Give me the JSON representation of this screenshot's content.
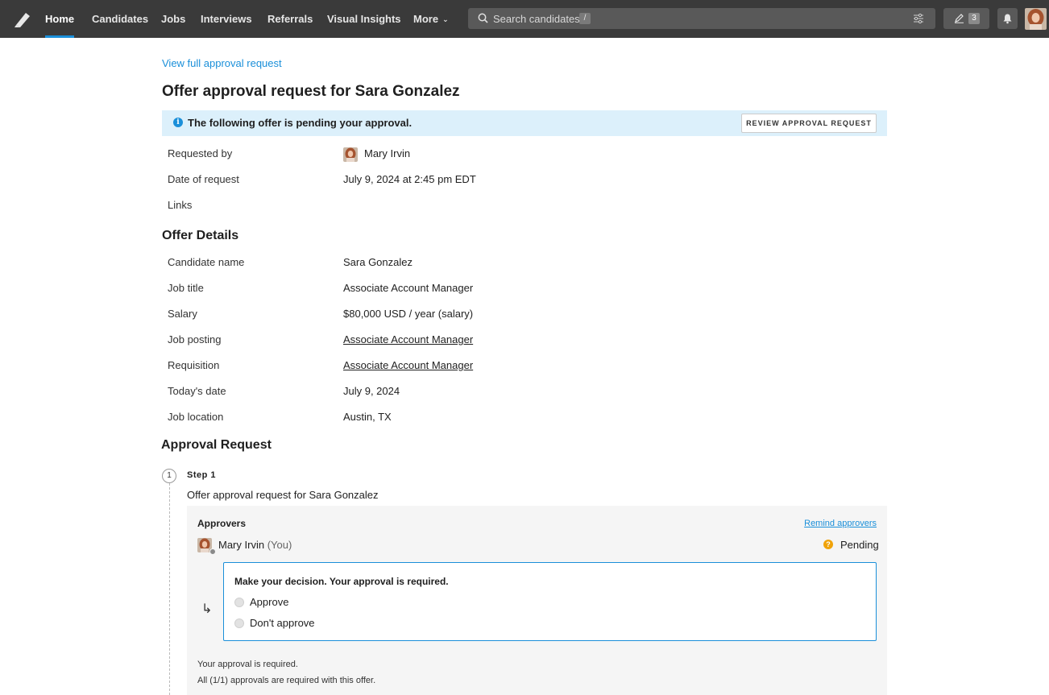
{
  "nav": {
    "items": [
      "Home",
      "Candidates",
      "Jobs",
      "Interviews",
      "Referrals",
      "Visual Insights",
      "More"
    ],
    "active": "Home",
    "search_placeholder": "Search candidates",
    "search_shortcut": "/",
    "edit_count": "3"
  },
  "page": {
    "view_full_link": "View full approval request",
    "title": "Offer approval request for Sara Gonzalez",
    "banner_text": "The following offer is pending your approval.",
    "review_button": "REVIEW APPROVAL REQUEST"
  },
  "request_info": [
    {
      "label": "Requested by",
      "value": "Mary Irvin"
    },
    {
      "label": "Date of request",
      "value": "July 9, 2024 at 2:45 pm EDT"
    },
    {
      "label": "Links",
      "value": ""
    }
  ],
  "offer_details": {
    "title": "Offer Details",
    "rows": [
      {
        "label": "Candidate name",
        "value": "Sara Gonzalez"
      },
      {
        "label": "Job title",
        "value": "Associate Account Manager"
      },
      {
        "label": "Salary",
        "value": "$80,000 USD / year (salary)"
      },
      {
        "label": "Job posting",
        "value": "Associate Account Manager"
      },
      {
        "label": "Requisition",
        "value": "Associate Account Manager"
      },
      {
        "label": "Today's date",
        "value": "July 9, 2024"
      },
      {
        "label": "Job location",
        "value": "Austin, TX"
      }
    ]
  },
  "approval": {
    "title": "Approval Request",
    "step_number": "1",
    "step_label": "Step 1",
    "step_desc": "Offer approval request for Sara Gonzalez",
    "approvers_title": "Approvers",
    "remind_link": "Remind approvers",
    "approver_name": "Mary Irvin",
    "approver_you": "(You)",
    "status": "Pending",
    "decision_title": "Make your decision. Your approval is required.",
    "options": [
      "Approve",
      "Don't approve"
    ],
    "note1": "Your approval is required.",
    "note2": "All (1/1) approvals are required with this offer."
  },
  "colors": {
    "accent": "#1a8fd9",
    "topbar": "#3a3a3a",
    "banner": "#dcf0fb",
    "pending": "#f0a30a"
  }
}
